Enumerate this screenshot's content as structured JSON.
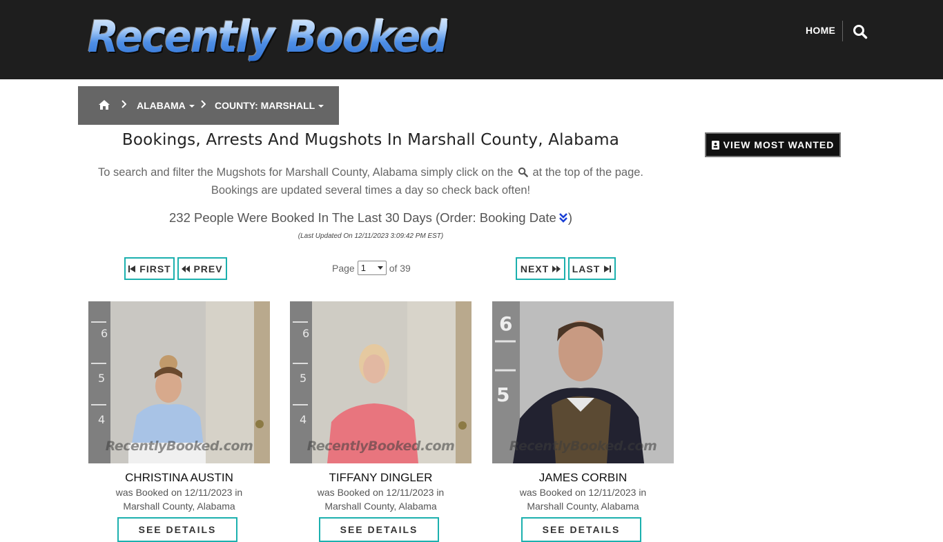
{
  "header": {
    "logo_text": "Recently Booked",
    "nav_home": "HOME",
    "search_icon": "search-icon"
  },
  "breadcrumb": {
    "home_icon": "home-icon",
    "separator": "›",
    "items": [
      {
        "label": "ALABAMA"
      },
      {
        "label": "COUNTY: MARSHALL"
      }
    ]
  },
  "main": {
    "title": "Bookings, Arrests And Mugshots In Marshall County, Alabama",
    "intro_part1": "To search and filter the Mugshots for Marshall County, Alabama simply click on the",
    "intro_part2": "at the top of the page.",
    "intro_line2": "Bookings are updated several times a day so check back often!",
    "count_text": "232 People Were Booked In The Last 30 Days (Order: Booking Date",
    "count_close": ")",
    "updated": "(Last Updated On 12/11/2023 3:09:42 PM EST)"
  },
  "pager": {
    "first": "FIRST",
    "prev": "PREV",
    "next": "NEXT",
    "last": "LAST",
    "page_label": "Page",
    "current_page": "1",
    "of_label": "of 39"
  },
  "sidebar": {
    "most_wanted": "VIEW MOST WANTED"
  },
  "cards": [
    {
      "name": "CHRISTINA AUSTIN",
      "line1": "was Booked on 12/11/2023 in",
      "line2": "Marshall County, Alabama",
      "button": "SEE DETAILS",
      "watermark": "RecentlyBooked.com"
    },
    {
      "name": "TIFFANY DINGLER",
      "line1": "was Booked on 12/11/2023 in",
      "line2": "Marshall County, Alabama",
      "button": "SEE DETAILS",
      "watermark": "RecentlyBooked.com"
    },
    {
      "name": "JAMES CORBIN",
      "line1": "was Booked on 12/11/2023 in",
      "line2": "Marshall County, Alabama",
      "button": "SEE DETAILS",
      "watermark": "RecentlyBooked.com"
    }
  ],
  "colors": {
    "header_bg": "#1e1e1e",
    "accent_teal": "#1bb0ae",
    "breadcrumb_bg": "#666666"
  }
}
